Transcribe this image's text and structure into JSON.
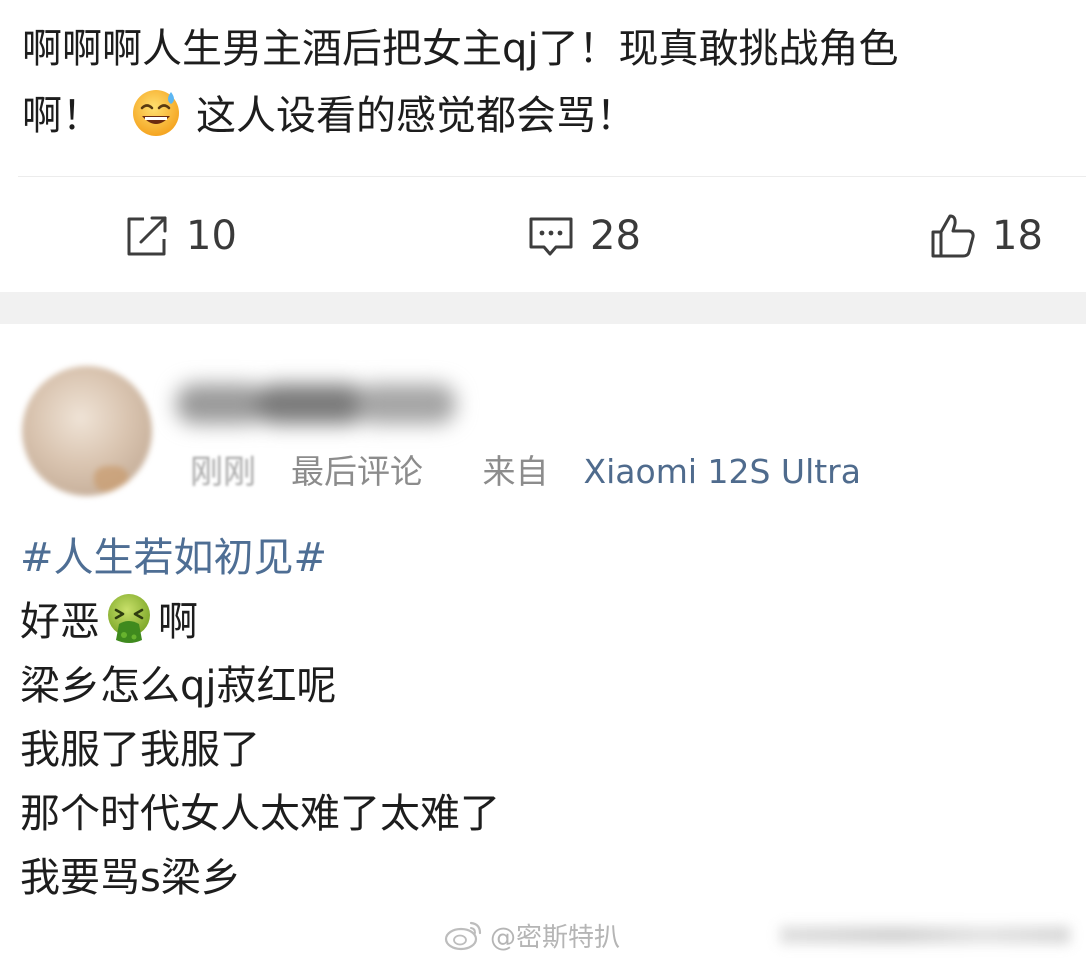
{
  "post": {
    "text_line1": "啊啊啊人生男主酒后把女主qj了！现真敢挑战角色",
    "text_line2_start": "啊！",
    "text_line2_end": "这人设看的感觉都会骂！",
    "emoji": "sweat-smile-emoji",
    "actions": {
      "repost_count": "10",
      "comment_count": "28",
      "like_count": "18"
    }
  },
  "comment": {
    "time": "刚刚",
    "last_comment_label": "最后评论",
    "source_prefix": "来自",
    "device": "Xiaomi 12S Ultra",
    "hashtag": "#人生若如初见#",
    "line1_start": "好恶",
    "line1_end": "啊",
    "line2": "梁乡怎么qj菽红呢",
    "line3": "我服了我服了",
    "line4": "那个时代女人太难了太难了",
    "line5": "我要骂s梁乡",
    "emoji": "vomit-emoji"
  },
  "watermark": {
    "text": "@密斯特扒"
  },
  "colors": {
    "text": "#1d1d1d",
    "meta": "#8c8c8c",
    "link": "#4e6e94",
    "separator": "#f1f1f1"
  }
}
